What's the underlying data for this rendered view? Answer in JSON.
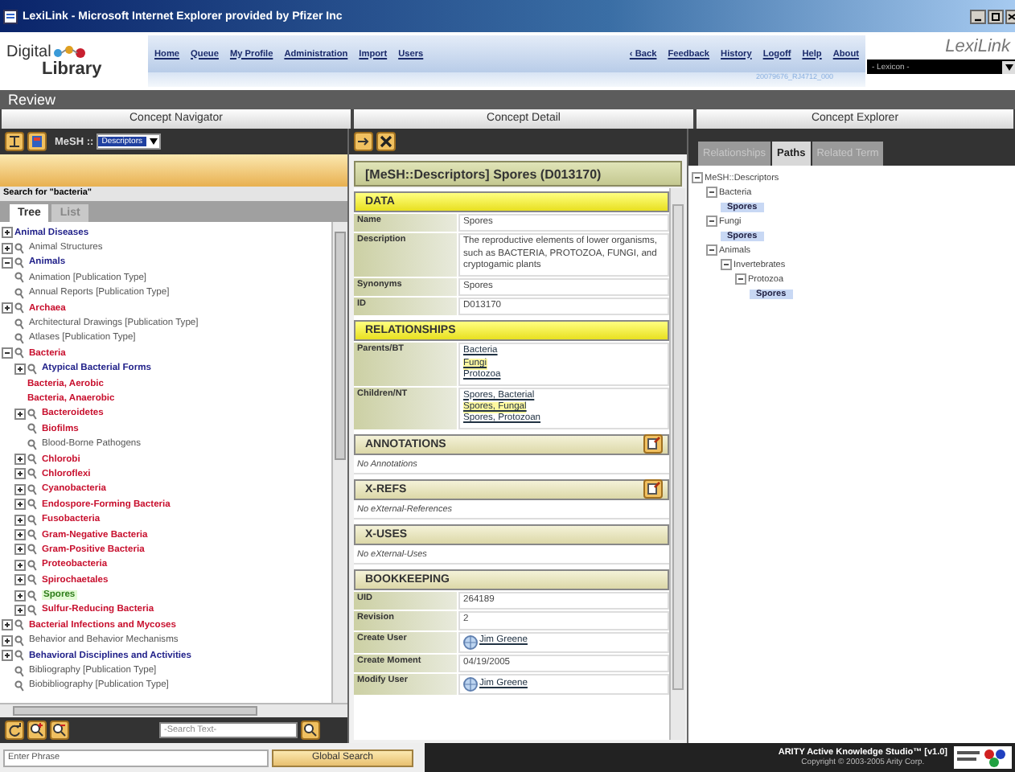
{
  "window": {
    "title": "LexiLink - Microsoft Internet Explorer provided by Pfizer Inc"
  },
  "header": {
    "logo_top": "Digital",
    "logo_bottom": "Library",
    "nav_left": [
      "Home",
      "Queue",
      "My Profile",
      "Administration",
      "Import",
      "Users"
    ],
    "nav_right": [
      "‹ Back",
      "Feedback",
      "History",
      "Logoff",
      "Help",
      "About"
    ],
    "session_code": "20079676_RJ4712_000",
    "brand": "LexiLink",
    "lexicon_select": "- Lexicon -"
  },
  "page_title": "Review",
  "navigator": {
    "title": "Concept Navigator",
    "scheme_label": "MeSH ::",
    "scheme_select": "Descriptors",
    "search_caption": "Search for \"bacteria\"",
    "tabs": [
      {
        "label": "Tree",
        "selected": true
      },
      {
        "label": "List",
        "selected": false
      }
    ],
    "tree": [
      {
        "label": "Animal Diseases",
        "kind": "branch",
        "expanded": false,
        "magnifier": false,
        "color": "#22228a",
        "bold": true,
        "selected": false
      },
      {
        "label": "Animal Structures",
        "kind": "branch",
        "expanded": false,
        "magnifier": true,
        "color": "#555555",
        "bold": false,
        "selected": false
      },
      {
        "label": "Animals",
        "kind": "branch",
        "expanded": true,
        "magnifier": true,
        "color": "#22228a",
        "bold": true,
        "selected": false
      },
      {
        "label": "Animation [Publication Type]",
        "kind": "leaf",
        "magnifier": true,
        "color": "#555555",
        "bold": false,
        "selected": false
      },
      {
        "label": "Annual Reports [Publication Type]",
        "kind": "leaf",
        "magnifier": true,
        "color": "#555555",
        "bold": false,
        "selected": false
      },
      {
        "label": "Archaea",
        "kind": "branch",
        "expanded": false,
        "magnifier": true,
        "color": "#c8102e",
        "bold": true,
        "selected": false
      },
      {
        "label": "Architectural Drawings [Publication Type]",
        "kind": "leaf",
        "magnifier": true,
        "color": "#555555",
        "bold": false,
        "selected": false
      },
      {
        "label": "Atlases [Publication Type]",
        "kind": "leaf",
        "magnifier": true,
        "color": "#555555",
        "bold": false,
        "selected": false
      },
      {
        "label": "Bacteria",
        "kind": "branch",
        "expanded": true,
        "magnifier": true,
        "color": "#c8102e",
        "bold": true,
        "selected": false,
        "children": [
          {
            "label": "Atypical Bacterial Forms",
            "kind": "branch",
            "expanded": false,
            "magnifier": true,
            "color": "#22228a",
            "bold": true,
            "selected": false
          },
          {
            "label": "Bacteria, Aerobic",
            "kind": "leaf",
            "magnifier": false,
            "color": "#c8102e",
            "bold": true,
            "selected": false
          },
          {
            "label": "Bacteria, Anaerobic",
            "kind": "leaf",
            "magnifier": false,
            "color": "#c8102e",
            "bold": true,
            "selected": false
          },
          {
            "label": "Bacteroidetes",
            "kind": "branch",
            "expanded": false,
            "magnifier": true,
            "color": "#c8102e",
            "bold": true,
            "selected": false
          },
          {
            "label": "Biofilms",
            "kind": "leaf",
            "magnifier": true,
            "color": "#c8102e",
            "bold": true,
            "selected": false
          },
          {
            "label": "Blood-Borne Pathogens",
            "kind": "leaf",
            "magnifier": true,
            "color": "#555555",
            "bold": false,
            "selected": false
          },
          {
            "label": "Chlorobi",
            "kind": "branch",
            "expanded": false,
            "magnifier": true,
            "color": "#c8102e",
            "bold": true,
            "selected": false
          },
          {
            "label": "Chloroflexi",
            "kind": "branch",
            "expanded": false,
            "magnifier": true,
            "color": "#c8102e",
            "bold": true,
            "selected": false
          },
          {
            "label": "Cyanobacteria",
            "kind": "branch",
            "expanded": false,
            "magnifier": true,
            "color": "#c8102e",
            "bold": true,
            "selected": false
          },
          {
            "label": "Endospore-Forming Bacteria",
            "kind": "branch",
            "expanded": false,
            "magnifier": true,
            "color": "#c8102e",
            "bold": true,
            "selected": false
          },
          {
            "label": "Fusobacteria",
            "kind": "branch",
            "expanded": false,
            "magnifier": true,
            "color": "#c8102e",
            "bold": true,
            "selected": false
          },
          {
            "label": "Gram-Negative Bacteria",
            "kind": "branch",
            "expanded": false,
            "magnifier": true,
            "color": "#c8102e",
            "bold": true,
            "selected": false
          },
          {
            "label": "Gram-Positive Bacteria",
            "kind": "branch",
            "expanded": false,
            "magnifier": true,
            "color": "#c8102e",
            "bold": true,
            "selected": false
          },
          {
            "label": "Proteobacteria",
            "kind": "branch",
            "expanded": false,
            "magnifier": true,
            "color": "#c8102e",
            "bold": true,
            "selected": false
          },
          {
            "label": "Spirochaetales",
            "kind": "branch",
            "expanded": false,
            "magnifier": true,
            "color": "#c8102e",
            "bold": true,
            "selected": false
          },
          {
            "label": "Spores",
            "kind": "branch",
            "expanded": false,
            "magnifier": true,
            "color": "#2e7d1a",
            "bold": true,
            "selected": true
          },
          {
            "label": "Sulfur-Reducing Bacteria",
            "kind": "branch",
            "expanded": false,
            "magnifier": true,
            "color": "#c8102e",
            "bold": true,
            "selected": false
          }
        ]
      },
      {
        "label": "Bacterial Infections and Mycoses",
        "kind": "branch",
        "expanded": false,
        "magnifier": true,
        "color": "#c8102e",
        "bold": true,
        "selected": false
      },
      {
        "label": "Behavior and Behavior Mechanisms",
        "kind": "branch",
        "expanded": false,
        "magnifier": true,
        "color": "#555555",
        "bold": false,
        "selected": false
      },
      {
        "label": "Behavioral Disciplines and Activities",
        "kind": "branch",
        "expanded": false,
        "magnifier": true,
        "color": "#22228a",
        "bold": true,
        "selected": false
      },
      {
        "label": "Bibliography [Publication Type]",
        "kind": "leaf",
        "magnifier": true,
        "color": "#555555",
        "bold": false,
        "selected": false
      },
      {
        "label": "Biobibliography [Publication Type]",
        "kind": "leaf",
        "magnifier": true,
        "color": "#555555",
        "bold": false,
        "selected": false
      }
    ],
    "search": {
      "placeholder": "-Search Text-"
    }
  },
  "detail": {
    "title": "Concept Detail",
    "heading": "[MeSH::Descriptors] Spores (D013170)",
    "sections": [
      {
        "title": "DATA",
        "highlighted": true,
        "add_button": false,
        "rows": [
          {
            "label": "Name",
            "kind": "text",
            "value": "Spores"
          },
          {
            "label": "Description",
            "kind": "text",
            "value": "The reproductive elements of lower organisms, such as BACTERIA, PROTOZOA, FUNGI, and cryptogamic plants"
          },
          {
            "label": "Synonyms",
            "kind": "text",
            "value": "Spores"
          },
          {
            "label": "ID",
            "kind": "text",
            "value": "D013170"
          }
        ]
      },
      {
        "title": "RELATIONSHIPS",
        "highlighted": true,
        "add_button": false,
        "rows": [
          {
            "label": "Parents/BT",
            "kind": "links",
            "links": [
              {
                "text": "Bacteria",
                "highlighted": false
              },
              {
                "text": "Fungi",
                "highlighted": true
              },
              {
                "text": "Protozoa",
                "highlighted": false
              }
            ]
          },
          {
            "label": "Children/NT",
            "kind": "links",
            "links": [
              {
                "text": "Spores, Bacterial",
                "highlighted": false
              },
              {
                "text": "Spores, Fungal",
                "highlighted": true
              },
              {
                "text": "Spores, Protozoan",
                "highlighted": false
              }
            ]
          }
        ]
      },
      {
        "title": "ANNOTATIONS",
        "highlighted": false,
        "add_button": true,
        "note": "No Annotations"
      },
      {
        "title": "X-REFS",
        "highlighted": false,
        "add_button": true,
        "note": "No eXternal-References"
      },
      {
        "title": "X-USES",
        "highlighted": false,
        "add_button": false,
        "note": "No eXternal-Uses"
      },
      {
        "title": "BOOKKEEPING",
        "highlighted": false,
        "add_button": false,
        "rows": [
          {
            "label": "UID",
            "kind": "text",
            "value": "264189"
          },
          {
            "label": "Revision",
            "kind": "text",
            "value": "2"
          },
          {
            "label": "Create User",
            "kind": "user",
            "value": "Jim Greene"
          },
          {
            "label": "Create Moment",
            "kind": "text",
            "value": "04/19/2005"
          },
          {
            "label": "Modify User",
            "kind": "user",
            "value": "Jim Greene"
          }
        ]
      }
    ]
  },
  "explorer": {
    "title": "Concept Explorer",
    "tabs": [
      {
        "label": "Relationships",
        "selected": false
      },
      {
        "label": "Paths",
        "selected": true
      },
      {
        "label": "Related Term",
        "selected": false
      }
    ],
    "tree": [
      {
        "label": "MeSH::Descriptors",
        "highlighted": false,
        "children": [
          {
            "label": "Bacteria",
            "highlighted": false,
            "children": [
              {
                "label": "Spores",
                "highlighted": true
              }
            ]
          },
          {
            "label": "Fungi",
            "highlighted": false,
            "children": [
              {
                "label": "Spores",
                "highlighted": true
              }
            ]
          },
          {
            "label": "Animals",
            "highlighted": false,
            "children": [
              {
                "label": "Invertebrates",
                "highlighted": false,
                "children": [
                  {
                    "label": "Protozoa",
                    "highlighted": false,
                    "children": [
                      {
                        "label": "Spores",
                        "highlighted": true
                      }
                    ]
                  }
                ]
              }
            ]
          }
        ]
      }
    ]
  },
  "footer": {
    "phrase": {
      "placeholder": "Enter Phrase"
    },
    "global_search": "Global Search",
    "product": "ARITY Active Knowledge Studio™ [v1.0]",
    "copyright": "Copyright © 2003-2005 Arity Corp."
  }
}
